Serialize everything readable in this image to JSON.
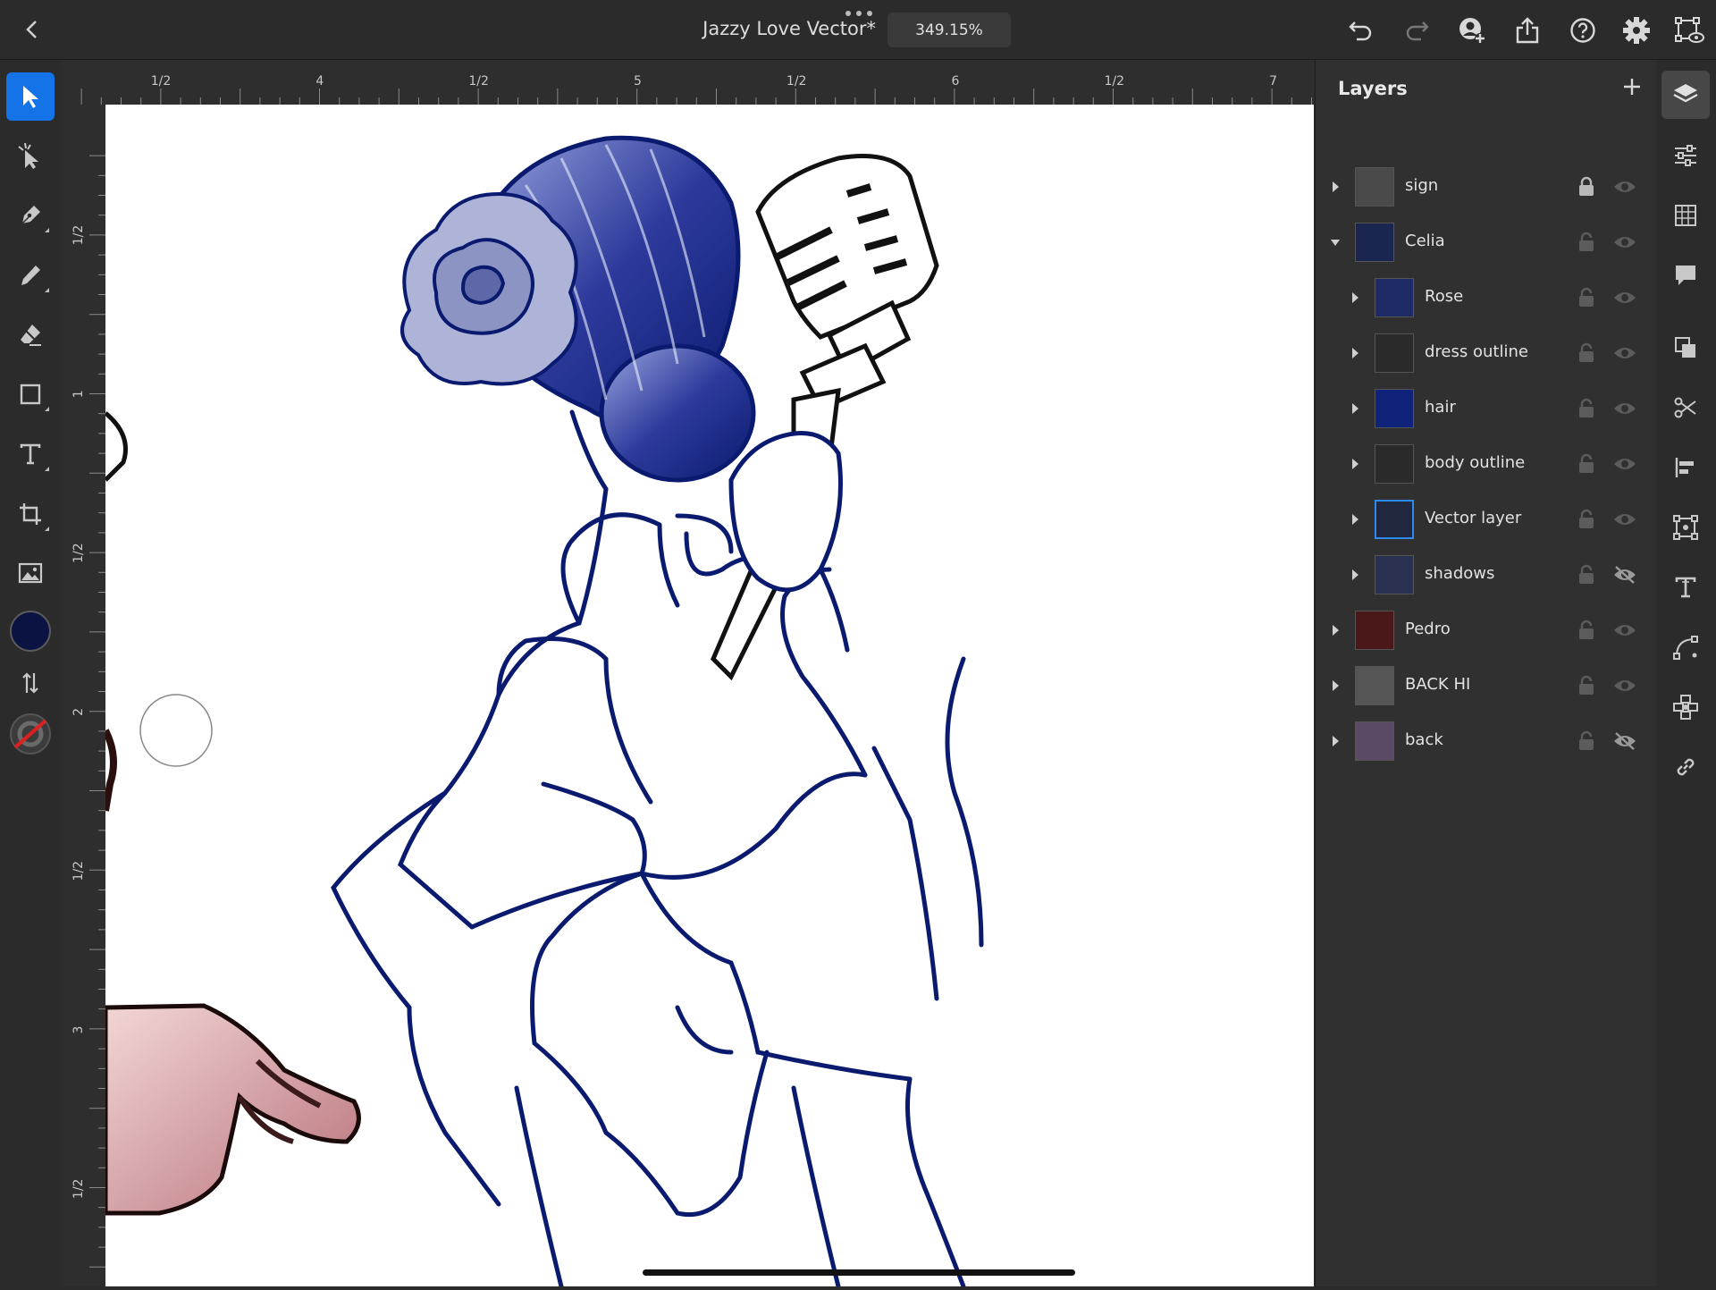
{
  "document": {
    "title": "Jazzy Love Vector*",
    "zoom": "349.15%"
  },
  "topbar": {
    "back_icon": "chevron-left-icon",
    "more_icon": "more-dots-icon",
    "actions": [
      "undo-icon",
      "redo-icon",
      "invite-icon",
      "share-icon",
      "help-icon",
      "settings-icon",
      "preview-icon"
    ]
  },
  "tools": {
    "items": [
      "select-tool-icon",
      "direct-select-icon",
      "pen-icon",
      "pencil-icon",
      "eraser-icon",
      "rectangle-icon",
      "type-icon",
      "artboard-icon",
      "image-icon",
      "fill-color-swatch",
      "swap-icon",
      "stroke-none-swatch"
    ],
    "fill_color": "#0a1342"
  },
  "rulers": {
    "top_labels": [
      "1/2",
      "4",
      "1/2",
      "5",
      "1/2",
      "6",
      "1/2",
      "7"
    ],
    "left_labels": [
      "1/2",
      "1",
      "1/2",
      "2",
      "1/2",
      "3",
      "1/2"
    ]
  },
  "layers_panel": {
    "title": "Layers",
    "add_icon": "plus-icon",
    "layers": [
      {
        "name": "sign",
        "indent": 0,
        "expanded": false,
        "locked": true,
        "visible": true
      },
      {
        "name": "Celia",
        "indent": 0,
        "expanded": true,
        "locked": false,
        "visible": true
      },
      {
        "name": "Rose",
        "indent": 1,
        "expanded": false,
        "locked": false,
        "visible": true
      },
      {
        "name": "dress outline",
        "indent": 1,
        "expanded": false,
        "locked": false,
        "visible": true
      },
      {
        "name": "hair",
        "indent": 1,
        "expanded": false,
        "locked": false,
        "visible": true
      },
      {
        "name": "body outline",
        "indent": 1,
        "expanded": false,
        "locked": false,
        "visible": true
      },
      {
        "name": "Vector layer",
        "indent": 1,
        "expanded": false,
        "locked": false,
        "visible": true,
        "selected": true
      },
      {
        "name": "shadows",
        "indent": 1,
        "expanded": false,
        "locked": false,
        "visible": false
      },
      {
        "name": "Pedro",
        "indent": 0,
        "expanded": false,
        "locked": false,
        "visible": true
      },
      {
        "name": "BACK HI",
        "indent": 0,
        "expanded": false,
        "locked": false,
        "visible": true
      },
      {
        "name": "back",
        "indent": 0,
        "expanded": false,
        "locked": false,
        "visible": false
      }
    ]
  },
  "right_toolbar": {
    "items": [
      "layers-icon",
      "properties-icon",
      "grid-icon",
      "comments-icon",
      "arrange-icon",
      "scissors-icon",
      "align-icon",
      "transform-icon",
      "text-properties-icon",
      "path-icon",
      "repeat-icon",
      "link-icon"
    ]
  },
  "colors": {
    "accent": "#1473e6",
    "ink": "#0a1a6e",
    "panel": "#303030"
  }
}
